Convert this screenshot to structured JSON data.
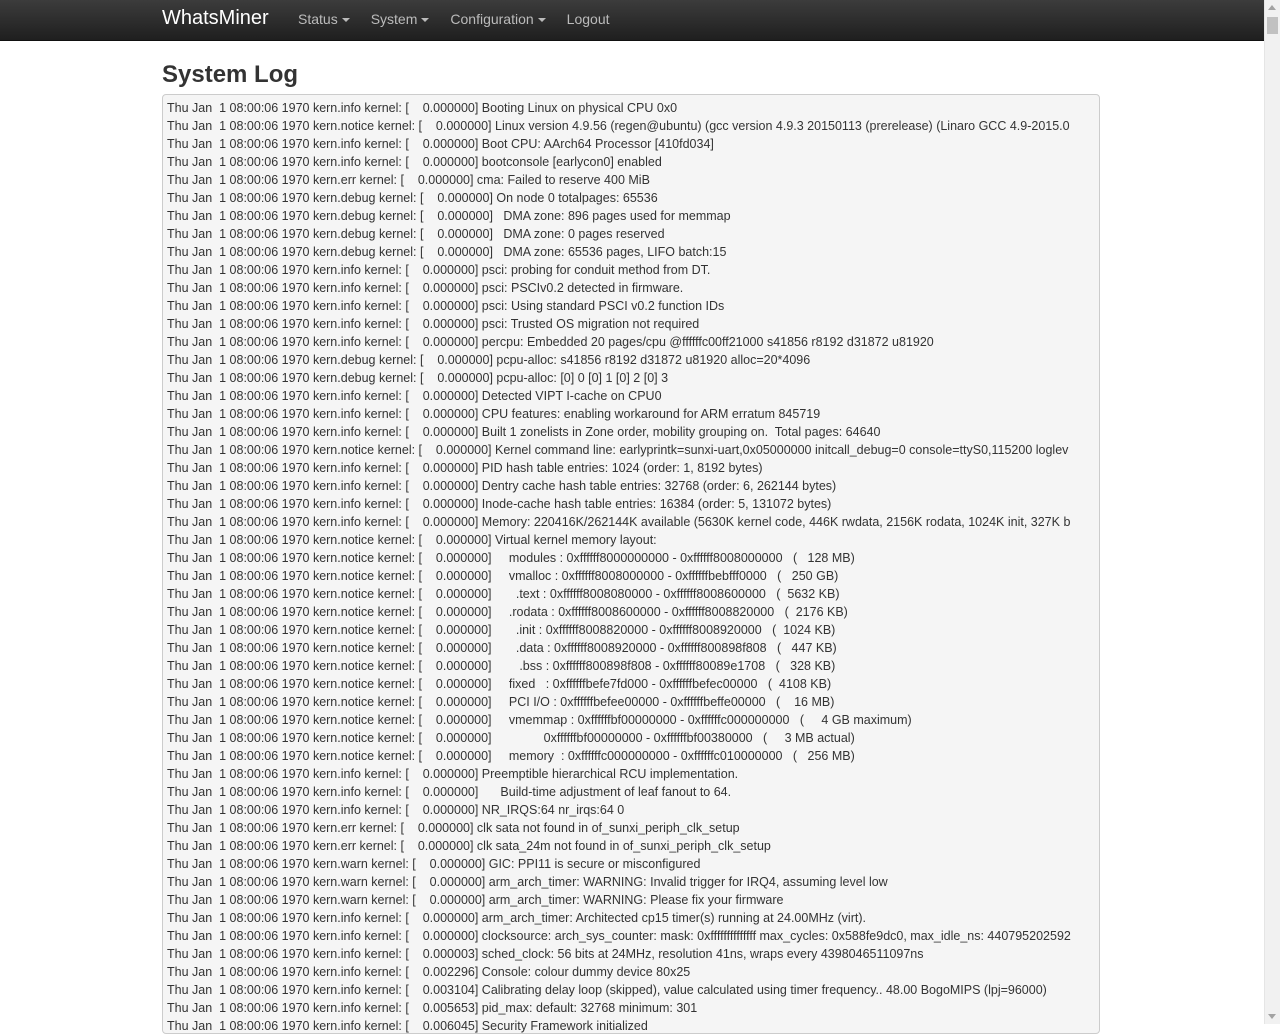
{
  "nav": {
    "brand": "WhatsMiner",
    "items": [
      {
        "label": "Status",
        "dropdown": true
      },
      {
        "label": "System",
        "dropdown": true
      },
      {
        "label": "Configuration",
        "dropdown": true
      },
      {
        "label": "Logout",
        "dropdown": false
      }
    ]
  },
  "page_title": "System Log",
  "log_lines": [
    "Thu Jan  1 08:00:06 1970 kern.info kernel: [    0.000000] Booting Linux on physical CPU 0x0",
    "Thu Jan  1 08:00:06 1970 kern.notice kernel: [    0.000000] Linux version 4.9.56 (regen@ubuntu) (gcc version 4.9.3 20150113 (prerelease) (Linaro GCC 4.9-2015.0",
    "Thu Jan  1 08:00:06 1970 kern.info kernel: [    0.000000] Boot CPU: AArch64 Processor [410fd034]",
    "Thu Jan  1 08:00:06 1970 kern.info kernel: [    0.000000] bootconsole [earlycon0] enabled",
    "Thu Jan  1 08:00:06 1970 kern.err kernel: [    0.000000] cma: Failed to reserve 400 MiB",
    "Thu Jan  1 08:00:06 1970 kern.debug kernel: [    0.000000] On node 0 totalpages: 65536",
    "Thu Jan  1 08:00:06 1970 kern.debug kernel: [    0.000000]   DMA zone: 896 pages used for memmap",
    "Thu Jan  1 08:00:06 1970 kern.debug kernel: [    0.000000]   DMA zone: 0 pages reserved",
    "Thu Jan  1 08:00:06 1970 kern.debug kernel: [    0.000000]   DMA zone: 65536 pages, LIFO batch:15",
    "Thu Jan  1 08:00:06 1970 kern.info kernel: [    0.000000] psci: probing for conduit method from DT.",
    "Thu Jan  1 08:00:06 1970 kern.info kernel: [    0.000000] psci: PSCIv0.2 detected in firmware.",
    "Thu Jan  1 08:00:06 1970 kern.info kernel: [    0.000000] psci: Using standard PSCI v0.2 function IDs",
    "Thu Jan  1 08:00:06 1970 kern.info kernel: [    0.000000] psci: Trusted OS migration not required",
    "Thu Jan  1 08:00:06 1970 kern.info kernel: [    0.000000] percpu: Embedded 20 pages/cpu @ffffffc00ff21000 s41856 r8192 d31872 u81920",
    "Thu Jan  1 08:00:06 1970 kern.debug kernel: [    0.000000] pcpu-alloc: s41856 r8192 d31872 u81920 alloc=20*4096",
    "Thu Jan  1 08:00:06 1970 kern.debug kernel: [    0.000000] pcpu-alloc: [0] 0 [0] 1 [0] 2 [0] 3",
    "Thu Jan  1 08:00:06 1970 kern.info kernel: [    0.000000] Detected VIPT I-cache on CPU0",
    "Thu Jan  1 08:00:06 1970 kern.info kernel: [    0.000000] CPU features: enabling workaround for ARM erratum 845719",
    "Thu Jan  1 08:00:06 1970 kern.info kernel: [    0.000000] Built 1 zonelists in Zone order, mobility grouping on.  Total pages: 64640",
    "Thu Jan  1 08:00:06 1970 kern.notice kernel: [    0.000000] Kernel command line: earlyprintk=sunxi-uart,0x05000000 initcall_debug=0 console=ttyS0,115200 loglev",
    "Thu Jan  1 08:00:06 1970 kern.info kernel: [    0.000000] PID hash table entries: 1024 (order: 1, 8192 bytes)",
    "Thu Jan  1 08:00:06 1970 kern.info kernel: [    0.000000] Dentry cache hash table entries: 32768 (order: 6, 262144 bytes)",
    "Thu Jan  1 08:00:06 1970 kern.info kernel: [    0.000000] Inode-cache hash table entries: 16384 (order: 5, 131072 bytes)",
    "Thu Jan  1 08:00:06 1970 kern.info kernel: [    0.000000] Memory: 220416K/262144K available (5630K kernel code, 446K rwdata, 2156K rodata, 1024K init, 327K b",
    "Thu Jan  1 08:00:06 1970 kern.notice kernel: [    0.000000] Virtual kernel memory layout:",
    "Thu Jan  1 08:00:06 1970 kern.notice kernel: [    0.000000]     modules : 0xffffff8000000000 - 0xffffff8008000000   (   128 MB)",
    "Thu Jan  1 08:00:06 1970 kern.notice kernel: [    0.000000]     vmalloc : 0xffffff8008000000 - 0xffffffbebfff0000   (   250 GB)",
    "Thu Jan  1 08:00:06 1970 kern.notice kernel: [    0.000000]       .text : 0xffffff8008080000 - 0xffffff8008600000   (  5632 KB)",
    "Thu Jan  1 08:00:06 1970 kern.notice kernel: [    0.000000]     .rodata : 0xffffff8008600000 - 0xffffff8008820000   (  2176 KB)",
    "Thu Jan  1 08:00:06 1970 kern.notice kernel: [    0.000000]       .init : 0xffffff8008820000 - 0xffffff8008920000   (  1024 KB)",
    "Thu Jan  1 08:00:06 1970 kern.notice kernel: [    0.000000]       .data : 0xffffff8008920000 - 0xffffff800898f808   (   447 KB)",
    "Thu Jan  1 08:00:06 1970 kern.notice kernel: [    0.000000]        .bss : 0xffffff800898f808 - 0xffffff80089e1708   (   328 KB)",
    "Thu Jan  1 08:00:06 1970 kern.notice kernel: [    0.000000]     fixed   : 0xffffffbefe7fd000 - 0xffffffbefec00000   (  4108 KB)",
    "Thu Jan  1 08:00:06 1970 kern.notice kernel: [    0.000000]     PCI I/O : 0xffffffbefee00000 - 0xffffffbeffe00000   (    16 MB)",
    "Thu Jan  1 08:00:06 1970 kern.notice kernel: [    0.000000]     vmemmap : 0xffffffbf00000000 - 0xffffffc000000000   (     4 GB maximum)",
    "Thu Jan  1 08:00:06 1970 kern.notice kernel: [    0.000000]               0xffffffbf00000000 - 0xffffffbf00380000   (     3 MB actual)",
    "Thu Jan  1 08:00:06 1970 kern.notice kernel: [    0.000000]     memory  : 0xffffffc000000000 - 0xffffffc010000000   (   256 MB)",
    "Thu Jan  1 08:00:06 1970 kern.info kernel: [    0.000000] Preemptible hierarchical RCU implementation.",
    "Thu Jan  1 08:00:06 1970 kern.info kernel: [    0.000000] \tBuild-time adjustment of leaf fanout to 64.",
    "Thu Jan  1 08:00:06 1970 kern.info kernel: [    0.000000] NR_IRQS:64 nr_irqs:64 0",
    "Thu Jan  1 08:00:06 1970 kern.err kernel: [    0.000000] clk sata not found in of_sunxi_periph_clk_setup",
    "Thu Jan  1 08:00:06 1970 kern.err kernel: [    0.000000] clk sata_24m not found in of_sunxi_periph_clk_setup",
    "Thu Jan  1 08:00:06 1970 kern.warn kernel: [    0.000000] GIC: PPI11 is secure or misconfigured",
    "Thu Jan  1 08:00:06 1970 kern.warn kernel: [    0.000000] arm_arch_timer: WARNING: Invalid trigger for IRQ4, assuming level low",
    "Thu Jan  1 08:00:06 1970 kern.warn kernel: [    0.000000] arm_arch_timer: WARNING: Please fix your firmware",
    "Thu Jan  1 08:00:06 1970 kern.info kernel: [    0.000000] arm_arch_timer: Architected cp15 timer(s) running at 24.00MHz (virt).",
    "Thu Jan  1 08:00:06 1970 kern.info kernel: [    0.000000] clocksource: arch_sys_counter: mask: 0xffffffffffffff max_cycles: 0x588fe9dc0, max_idle_ns: 440795202592",
    "Thu Jan  1 08:00:06 1970 kern.info kernel: [    0.000003] sched_clock: 56 bits at 24MHz, resolution 41ns, wraps every 4398046511097ns",
    "Thu Jan  1 08:00:06 1970 kern.info kernel: [    0.002296] Console: colour dummy device 80x25",
    "Thu Jan  1 08:00:06 1970 kern.info kernel: [    0.003104] Calibrating delay loop (skipped), value calculated using timer frequency.. 48.00 BogoMIPS (lpj=96000)",
    "Thu Jan  1 08:00:06 1970 kern.info kernel: [    0.005653] pid_max: default: 32768 minimum: 301",
    "Thu Jan  1 08:00:06 1970 kern.info kernel: [    0.006045] Security Framework initialized"
  ]
}
